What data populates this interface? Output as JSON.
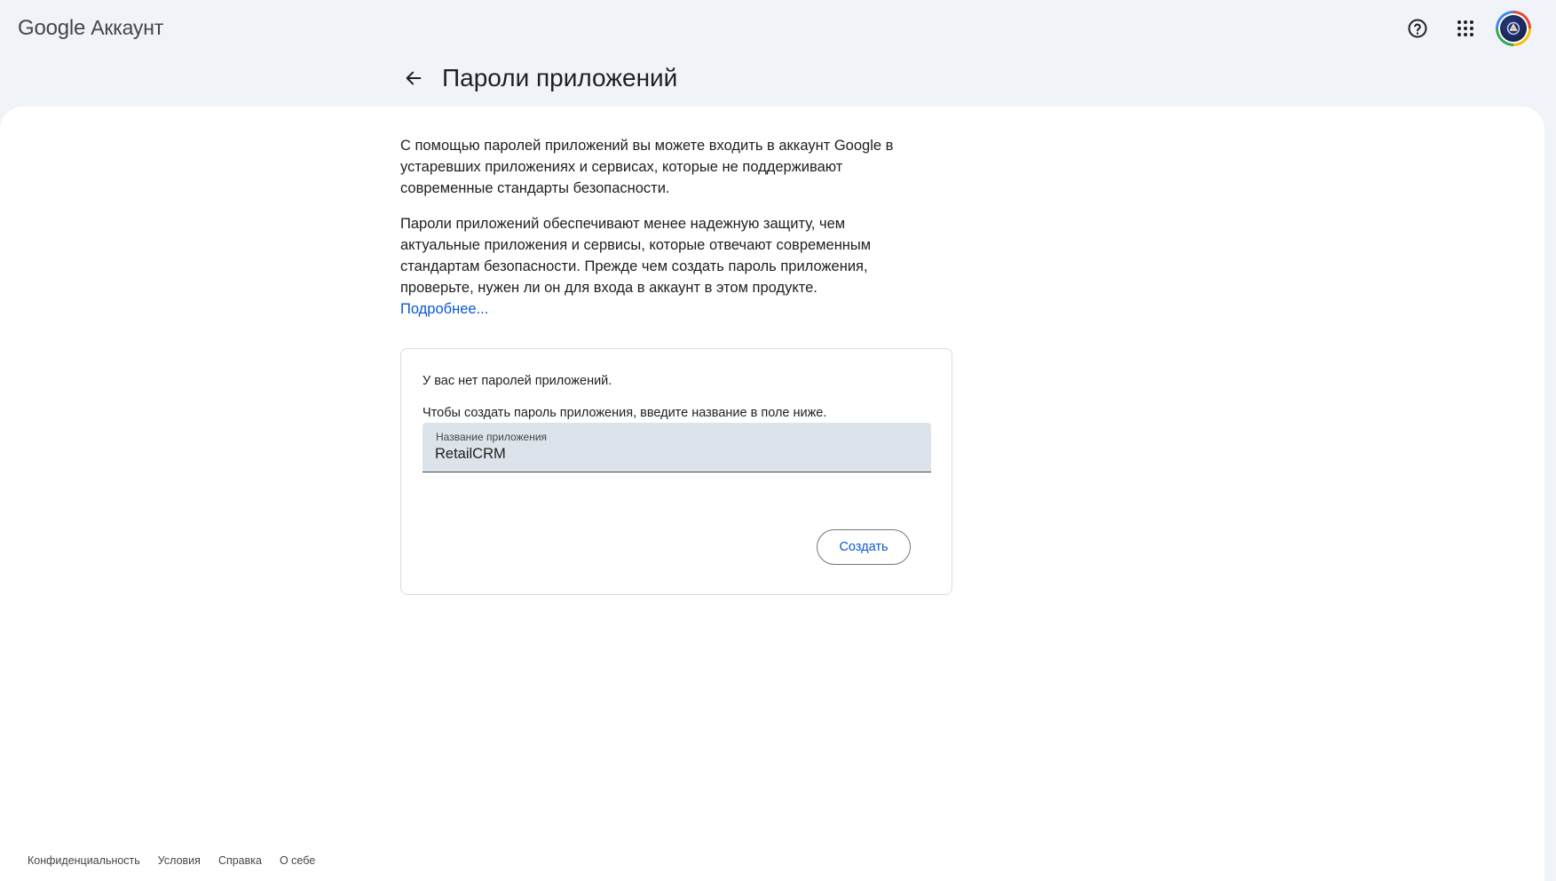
{
  "header": {
    "logo_google": "Google",
    "logo_account": "Аккаунт",
    "icons": [
      "help-icon",
      "apps-grid-icon",
      "avatar"
    ]
  },
  "page": {
    "title": "Пароли приложений",
    "intro_1": "С помощью паролей приложений вы можете входить в аккаунт Google в устаревших приложениях и сервисах, которые не поддерживают современные стандарты безопасности.",
    "intro_2": "Пароли приложений обеспечивают менее надежную защиту, чем актуальные приложения и сервисы, которые отвечают современным стандартам безопасности. Прежде чем создать пароль приложения, проверьте, нужен ли он для входа в аккаунт в этом продукте.",
    "learn_more": "Подробнее..."
  },
  "card": {
    "no_passwords": "У вас нет паролей приложений.",
    "instruction": "Чтобы создать пароль приложения, введите название в поле ниже.",
    "field_label": "Название приложения",
    "field_value": "RetailCRM",
    "create_label": "Создать"
  },
  "footer": {
    "links": [
      "Конфиденциальность",
      "Условия",
      "Справка",
      "О себе"
    ]
  },
  "colors": {
    "background": "#f0f4f9",
    "link": "#0b57d0",
    "field_bg": "#dde3ea"
  }
}
